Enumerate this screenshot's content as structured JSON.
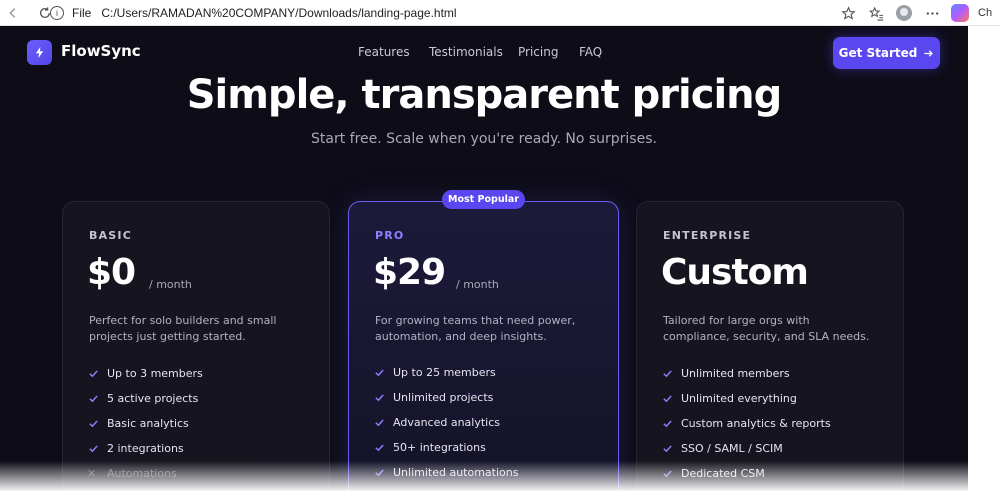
{
  "browser": {
    "scheme": "File",
    "url": "C:/Users/RAMADAN%20COMPANY/Downloads/landing-page.html",
    "profile_label": "Ch"
  },
  "nav": {
    "brand": "FlowSync",
    "links": [
      "Features",
      "Testimonials",
      "Pricing",
      "FAQ"
    ],
    "cta": "Get Started"
  },
  "hero": {
    "title": "Simple, transparent pricing",
    "subtitle": "Start free. Scale when you're ready. No surprises."
  },
  "plans": [
    {
      "tier": "BASIC",
      "price": "$0",
      "period": "/ month",
      "description": "Perfect for solo builders and small projects just getting started.",
      "features": [
        {
          "text": "Up to 3 members",
          "included": true
        },
        {
          "text": "5 active projects",
          "included": true
        },
        {
          "text": "Basic analytics",
          "included": true
        },
        {
          "text": "2 integrations",
          "included": true
        },
        {
          "text": "Automations",
          "included": false
        }
      ]
    },
    {
      "tier": "PRO",
      "badge": "Most Popular",
      "price": "$29",
      "period": "/ month",
      "description": "For growing teams that need power, automation, and deep insights.",
      "features": [
        {
          "text": "Up to 25 members",
          "included": true
        },
        {
          "text": "Unlimited projects",
          "included": true
        },
        {
          "text": "Advanced analytics",
          "included": true
        },
        {
          "text": "50+ integrations",
          "included": true
        },
        {
          "text": "Unlimited automations",
          "included": true
        }
      ]
    },
    {
      "tier": "ENTERPRISE",
      "price": "Custom",
      "description": "Tailored for large orgs with compliance, security, and SLA needs.",
      "features": [
        {
          "text": "Unlimited members",
          "included": true
        },
        {
          "text": "Unlimited everything",
          "included": true
        },
        {
          "text": "Custom analytics & reports",
          "included": true
        },
        {
          "text": "SSO / SAML / SCIM",
          "included": true
        },
        {
          "text": "Dedicated CSM",
          "included": true
        }
      ]
    }
  ],
  "colors": {
    "background": "#0d0c17",
    "accent": "#5b47f0",
    "check": "#8f80ff"
  }
}
